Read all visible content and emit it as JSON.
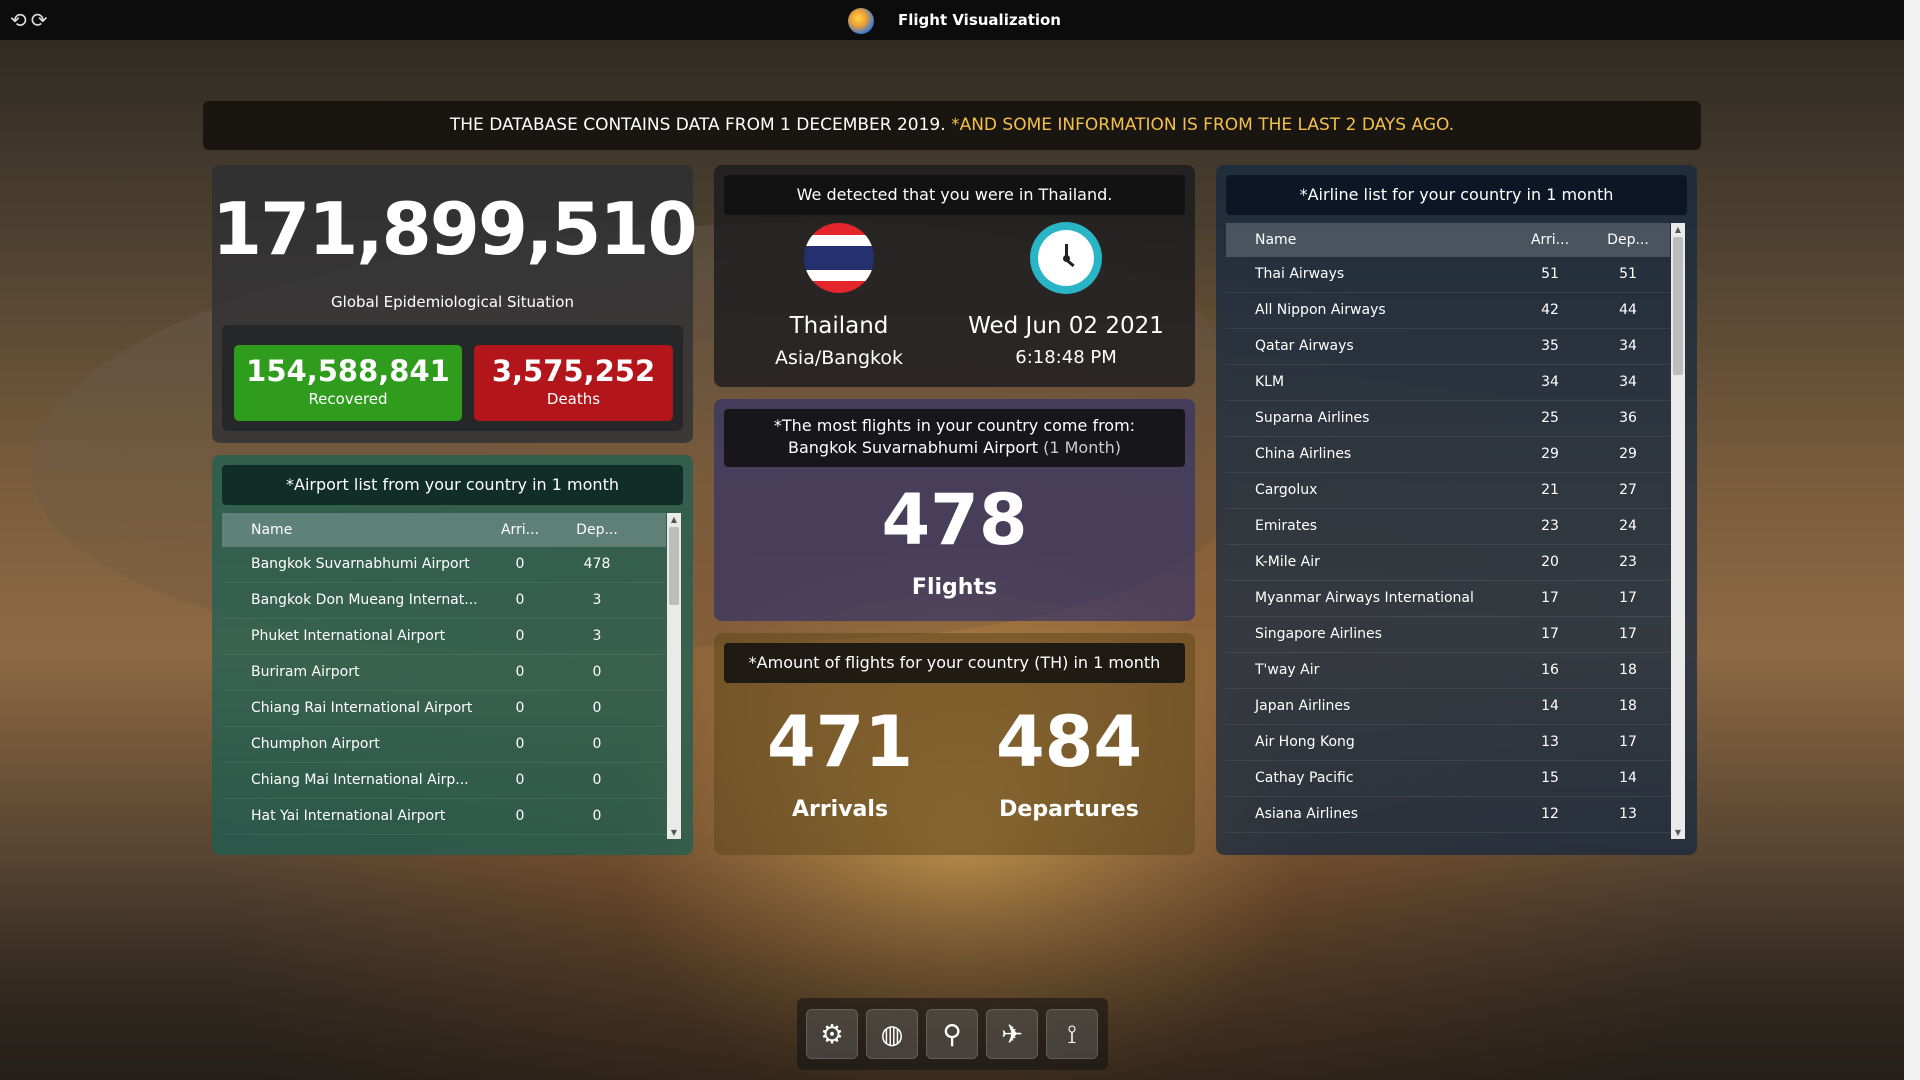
{
  "app": {
    "title": "Flight Visualization"
  },
  "nav": {
    "back": "⟲",
    "forward": "⟳"
  },
  "banner": {
    "part1": "THE DATABASE CONTAINS DATA FROM 1 DECEMBER 2019. ",
    "part2": "*AND SOME INFORMATION IS FROM THE LAST 2 DAYS AGO."
  },
  "global": {
    "number": "171,899,510",
    "label": "Global Epidemiological Situation",
    "recovered_value": "154,588,841",
    "recovered_label": "Recovered",
    "deaths_value": "3,575,252",
    "deaths_label": "Deaths"
  },
  "airports": {
    "title": "*Airport list from your country in 1 month",
    "headers": {
      "name": "Name",
      "arr": "Arri...",
      "dep": "Dep..."
    },
    "rows": [
      {
        "name": "Bangkok Suvarnabhumi Airport",
        "arr": "0",
        "dep": "478"
      },
      {
        "name": "Bangkok Don Mueang Internat...",
        "arr": "0",
        "dep": "3"
      },
      {
        "name": "Phuket International Airport",
        "arr": "0",
        "dep": "3"
      },
      {
        "name": "Buriram Airport",
        "arr": "0",
        "dep": "0"
      },
      {
        "name": "Chiang Rai International Airport",
        "arr": "0",
        "dep": "0"
      },
      {
        "name": "Chumphon Airport",
        "arr": "0",
        "dep": "0"
      },
      {
        "name": "Chiang Mai International Airp...",
        "arr": "0",
        "dep": "0"
      },
      {
        "name": "Hat Yai International Airport",
        "arr": "0",
        "dep": "0"
      }
    ]
  },
  "location": {
    "title": "We detected that you were in Thailand.",
    "country": "Thailand",
    "timezone": "Asia/Bangkok",
    "date": "Wed Jun 02 2021",
    "time": "6:18:48 PM"
  },
  "most_flights": {
    "line1": "*The most flights in your country come from:",
    "airport": "Bangkok Suvarnabhumi Airport",
    "period": " (1 Month)",
    "number": "478",
    "label": "Flights"
  },
  "amount": {
    "title": "*Amount of flights for your country (TH) in 1 month",
    "arrivals_value": "471",
    "arrivals_label": "Arrivals",
    "departures_value": "484",
    "departures_label": "Departures"
  },
  "airlines": {
    "title": "*Airline list for your country in 1 month",
    "headers": {
      "name": "Name",
      "arr": "Arri...",
      "dep": "Dep..."
    },
    "rows": [
      {
        "name": "Thai Airways",
        "arr": "51",
        "dep": "51"
      },
      {
        "name": "All Nippon Airways",
        "arr": "42",
        "dep": "44"
      },
      {
        "name": "Qatar Airways",
        "arr": "35",
        "dep": "34"
      },
      {
        "name": "KLM",
        "arr": "34",
        "dep": "34"
      },
      {
        "name": "Suparna Airlines",
        "arr": "25",
        "dep": "36"
      },
      {
        "name": "China Airlines",
        "arr": "29",
        "dep": "29"
      },
      {
        "name": "Cargolux",
        "arr": "21",
        "dep": "27"
      },
      {
        "name": "Emirates",
        "arr": "23",
        "dep": "24"
      },
      {
        "name": "K-Mile Air",
        "arr": "20",
        "dep": "23"
      },
      {
        "name": "Myanmar Airways International",
        "arr": "17",
        "dep": "17"
      },
      {
        "name": "Singapore Airlines",
        "arr": "17",
        "dep": "17"
      },
      {
        "name": "T'way Air",
        "arr": "16",
        "dep": "18"
      },
      {
        "name": "Japan Airlines",
        "arr": "14",
        "dep": "18"
      },
      {
        "name": "Air Hong Kong",
        "arr": "13",
        "dep": "17"
      },
      {
        "name": "Cathay Pacific",
        "arr": "15",
        "dep": "14"
      },
      {
        "name": "Asiana Airlines",
        "arr": "12",
        "dep": "13"
      }
    ]
  },
  "toolbar": {
    "buttons": [
      {
        "name": "settings-gears-icon",
        "glyph": "⚙"
      },
      {
        "name": "globe-icon",
        "glyph": "◍"
      },
      {
        "name": "map-pin-icon",
        "glyph": "⚲"
      },
      {
        "name": "plane-takeoff-icon",
        "glyph": "✈"
      },
      {
        "name": "route-icon",
        "glyph": "⟟"
      }
    ]
  },
  "colors": {
    "recovered": "#2f9c1e",
    "deaths": "#b3161a",
    "banner_highlight": "#f3c04a",
    "clock": "#2ab5c6"
  }
}
